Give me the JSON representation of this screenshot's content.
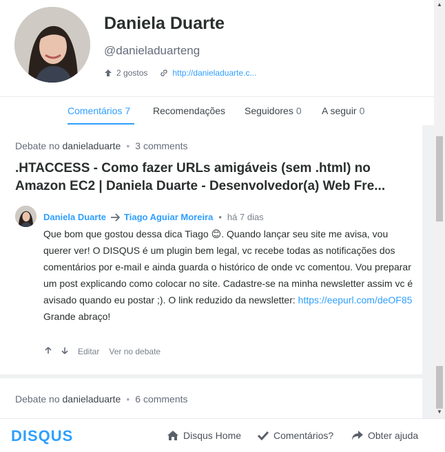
{
  "profile": {
    "name": "Daniela Duarte",
    "handle": "@danieladuarteng",
    "likes": "2 gostos",
    "website": "http://danieladuarte.c..."
  },
  "tabs": [
    {
      "label": "Comentários",
      "count": "7"
    },
    {
      "label": "Recomendações",
      "count": ""
    },
    {
      "label": "Seguidores",
      "count": "0"
    },
    {
      "label": "A seguir",
      "count": "0"
    }
  ],
  "feed": {
    "card1": {
      "prefix": "Debate no",
      "forum": "danieladuarte",
      "comments": "3 comments",
      "title": ".HTACCESS - Como fazer URLs amigáveis (sem .html) no Amazon EC2 | Daniela Duarte - Desenvolvedor(a) Web Fre...",
      "author": "Daniela Duarte",
      "reply_to": "Tiago Aguiar Moreira",
      "time": "há 7 dias",
      "body_1": "Que bom que gostou dessa dica Tiago",
      "emoji": "😊",
      "body_2": ". Quando lançar seu site me avisa, vou querer ver! O DISQUS é um plugin bem legal, vc recebe todas as notificações dos comentários por e-mail e ainda guarda o histórico de onde vc comentou. Vou preparar um post explicando como colocar no site. Cadastre-se na minha newsletter assim vc é avisado quando eu postar ;). O link reduzido da newsletter: ",
      "link": "https://eepurl.com/deOF85",
      "body_3": "Grande abraço!",
      "edit": "Editar",
      "view": "Ver no debate"
    },
    "card2": {
      "prefix": "Debate no",
      "forum": "danieladuarte",
      "comments": "6 comments"
    }
  },
  "footer": {
    "logo": "DISQUS",
    "home": "Disqus Home",
    "comments": "Comentários?",
    "help": "Obter ajuda"
  },
  "colors": {
    "accent": "#2e9fff",
    "text": "#2a2e2e",
    "muted": "#656c7a"
  }
}
